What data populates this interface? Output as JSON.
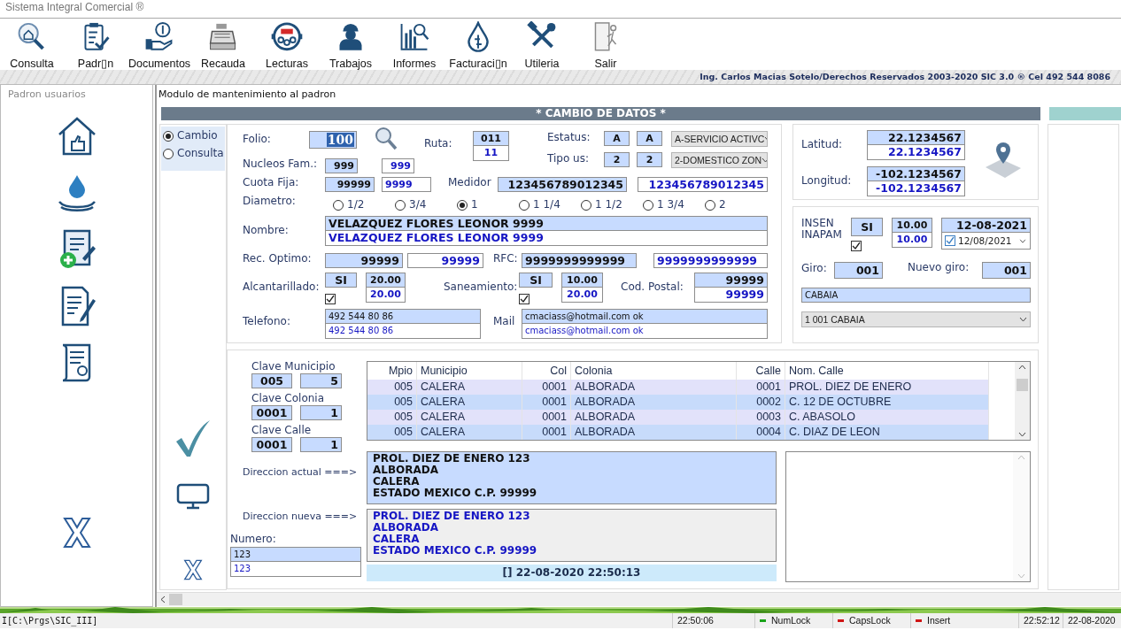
{
  "window": {
    "title": "Sistema Integral Comercial ®"
  },
  "toolbar": [
    "Consulta",
    "Padr▯n",
    "Documentos",
    "Recauda",
    "Lecturas",
    "Trabajos",
    "Informes",
    "Facturaci▯n",
    "Utileria",
    "Salir"
  ],
  "credits": "Ing. Carlos Macias Sotelo/Derechos Reservados 2003-2020 SIC 3.0 ®  Cel 492 544 8086",
  "sidebar": {
    "title": "Padron usuarios"
  },
  "module": {
    "title": "Modulo de mantenimiento al padron",
    "header": "* CAMBIO DE DATOS *"
  },
  "mode": [
    {
      "label": "Cambio",
      "selected": true
    },
    {
      "label": "Consulta",
      "selected": false
    }
  ],
  "form": {
    "folio": {
      "label": "Folio:",
      "value": "100"
    },
    "ruta": {
      "label": "Ruta:",
      "values": [
        "011",
        "11"
      ]
    },
    "estatus": {
      "label": "Estatus:",
      "values": [
        "A",
        "A"
      ],
      "select": "A-SERVICIO ACTIVC"
    },
    "tipo_us": {
      "label": "Tipo us:",
      "values": [
        "2",
        "2"
      ],
      "select": "2-DOMESTICO ZON"
    },
    "nucleos": {
      "label": "Nucleos Fam.:",
      "values": [
        "999",
        "999"
      ]
    },
    "cuota_fija": {
      "label": "Cuota Fija:",
      "values": [
        "99999",
        "9999"
      ]
    },
    "medidor": {
      "label": "Medidor",
      "values": [
        "123456789012345",
        "123456789012345"
      ]
    },
    "diametro": {
      "label": "Diametro:",
      "options": [
        {
          "label": "1/2",
          "selected": false
        },
        {
          "label": "3/4",
          "selected": false
        },
        {
          "label": "1",
          "selected": true
        },
        {
          "label": "1 1/4",
          "selected": false
        },
        {
          "label": "1 1/2",
          "selected": false
        },
        {
          "label": "1 3/4",
          "selected": false
        },
        {
          "label": "2",
          "selected": false
        }
      ]
    },
    "nombre": {
      "label": "Nombre:",
      "values": [
        "VELAZQUEZ FLORES LEONOR 9999",
        "VELAZQUEZ FLORES LEONOR 9999"
      ]
    },
    "rec_optimo": {
      "label": "Rec. Optimo:",
      "values": [
        "99999",
        "99999"
      ]
    },
    "rfc": {
      "label": "RFC:",
      "values": [
        "9999999999999",
        "9999999999999"
      ]
    },
    "alcantarillado": {
      "label": "Alcantarillado:",
      "flag": "SI",
      "checked": true,
      "amounts": [
        "20.00",
        "20.00"
      ]
    },
    "saneamiento": {
      "label": "Saneamiento:",
      "flag": "SI",
      "checked": true,
      "amounts": [
        "10.00",
        "20.00"
      ]
    },
    "cod_postal": {
      "label": "Cod. Postal:",
      "values": [
        "99999",
        "99999"
      ]
    },
    "telefono": {
      "label": "Telefono:",
      "values": [
        "492 544 80 86",
        "492 544 80 86"
      ]
    },
    "mail": {
      "label": "Mail",
      "values": [
        "cmaciass@hotmail.com ok",
        "cmaciass@hotmail.com ok"
      ]
    }
  },
  "location": {
    "latitud": {
      "label": "Latitud:",
      "values": [
        "22.1234567",
        "22.1234567"
      ]
    },
    "longitud": {
      "label": "Longitud:",
      "values": [
        "-102.1234567",
        "-102.1234567"
      ]
    }
  },
  "insen": {
    "label": "INSEN INAPAM",
    "flag": "SI",
    "checked": true,
    "amounts": [
      "10.00",
      "10.00"
    ],
    "date": "12-08-2021",
    "date_picker": {
      "value": "12/08/2021",
      "checked": true
    }
  },
  "giro": {
    "label": "Giro:",
    "value": "001",
    "new_label": "Nuevo giro:",
    "new_value": "001",
    "name": "CABAIA",
    "select": "1 001 CABAIA"
  },
  "claves": [
    {
      "label": "Clave Municipio",
      "values": [
        "005",
        "5"
      ]
    },
    {
      "label": "Clave Colonia",
      "values": [
        "0001",
        "1"
      ]
    },
    {
      "label": "Clave Calle",
      "values": [
        "0001",
        "1"
      ]
    }
  ],
  "streets": {
    "columns": [
      "Mpio",
      "Municipio",
      "Col",
      "Colonia",
      "Calle",
      "Nom. Calle"
    ],
    "rows": [
      [
        "005",
        "CALERA",
        "0001",
        "ALBORADA",
        "0001",
        "PROL. DIEZ DE ENERO"
      ],
      [
        "005",
        "CALERA",
        "0001",
        "ALBORADA",
        "0002",
        "C. 12 DE OCTUBRE"
      ],
      [
        "005",
        "CALERA",
        "0001",
        "ALBORADA",
        "0003",
        "C. ABASOLO"
      ],
      [
        "005",
        "CALERA",
        "0001",
        "ALBORADA",
        "0004",
        "C. DIAZ DE LEON"
      ]
    ]
  },
  "address": {
    "current_label": "Direccion actual ===>",
    "current": [
      "PROL. DIEZ DE ENERO 123",
      "ALBORADA",
      "CALERA",
      "ESTADO MEXICO C.P. 99999"
    ],
    "new_label": "Direccion nueva ===>",
    "new": [
      "PROL. DIEZ DE ENERO 123",
      "ALBORADA",
      "CALERA",
      "ESTADO MEXICO C.P. 99999"
    ]
  },
  "numero": {
    "label": "Numero:",
    "values": [
      "123",
      "123"
    ]
  },
  "timestamp": "[] 22-08-2020 22:50:13",
  "status_bar": {
    "path": "I[C:\\Prgs\\SIC_III]",
    "time": "22:50:06",
    "indicators": [
      {
        "label": "NumLock",
        "on": true
      },
      {
        "label": "CapsLock",
        "on": false
      },
      {
        "label": "Insert",
        "on": false
      }
    ],
    "clock": "22:52:12",
    "date": "22-08-2020"
  }
}
